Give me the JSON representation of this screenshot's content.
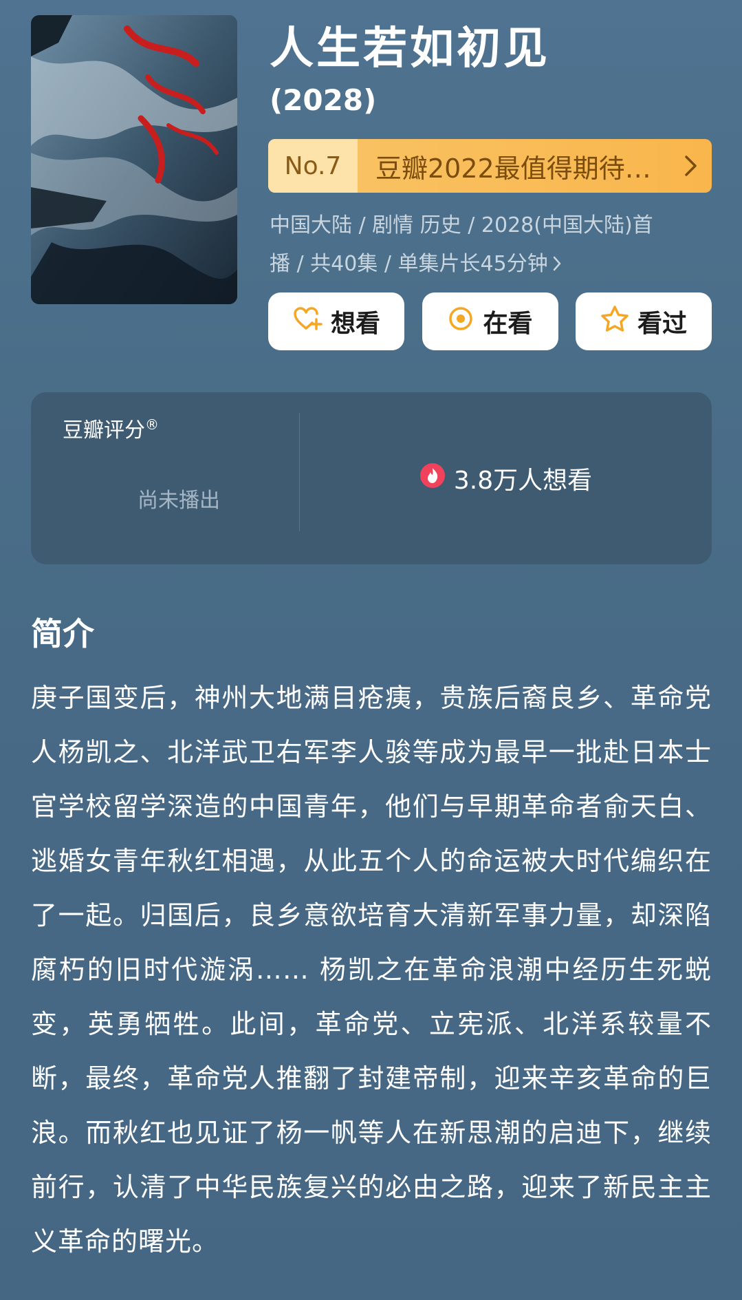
{
  "title": "人生若如初见",
  "year": "(2028)",
  "rank": {
    "number": "No.7",
    "text": "豆瓣2022最值得期待…"
  },
  "meta": {
    "line1": "中国大陆 / 剧情 历史 / 2028(中国大陆)首",
    "line2": "播 / 共40集 / 单集片长45分钟"
  },
  "actions": {
    "want": "想看",
    "watching": "在看",
    "watched": "看过"
  },
  "rating": {
    "label": "豆瓣评分",
    "registered": "®",
    "status": "尚未播出",
    "interest": "3.8万人想看"
  },
  "synopsis": {
    "heading": "简介",
    "body": "庚子国变后，神州大地满目疮痍，贵族后裔良乡、革命党人杨凯之、北洋武卫右军李人骏等成为最早一批赴日本士官学校留学深造的中国青年，他们与早期革命者俞天白、逃婚女青年秋红相遇，从此五个人的命运被大时代编织在了一起。归国后，良乡意欲培育大清新军事力量，却深陷腐朽的旧时代漩涡…… 杨凯之在革命浪潮中经历生死蜕变，英勇牺牲。此间，革命党、立宪派、北洋系较量不断，最终，革命党人推翻了封建帝制，迎来辛亥革命的巨浪。而秋红也见证了杨一帆等人在新思潮的启迪下，继续前行，认清了中华民族复兴的必由之路，迎来了新民主主义革命的曙光。"
  },
  "colors": {
    "background": "#4a6d88",
    "accent_orange": "#f9b64c",
    "rank_text": "#7a4c0e",
    "icon_orange": "#f5a623",
    "fire_red": "#f0435b"
  },
  "icons": {
    "rank_chevron": "chevron-right-icon",
    "meta_chevron": "chevron-right-icon",
    "want": "heart-plus-icon",
    "watching": "target-circle-icon",
    "watched": "star-outline-icon",
    "interest": "fire-icon"
  }
}
